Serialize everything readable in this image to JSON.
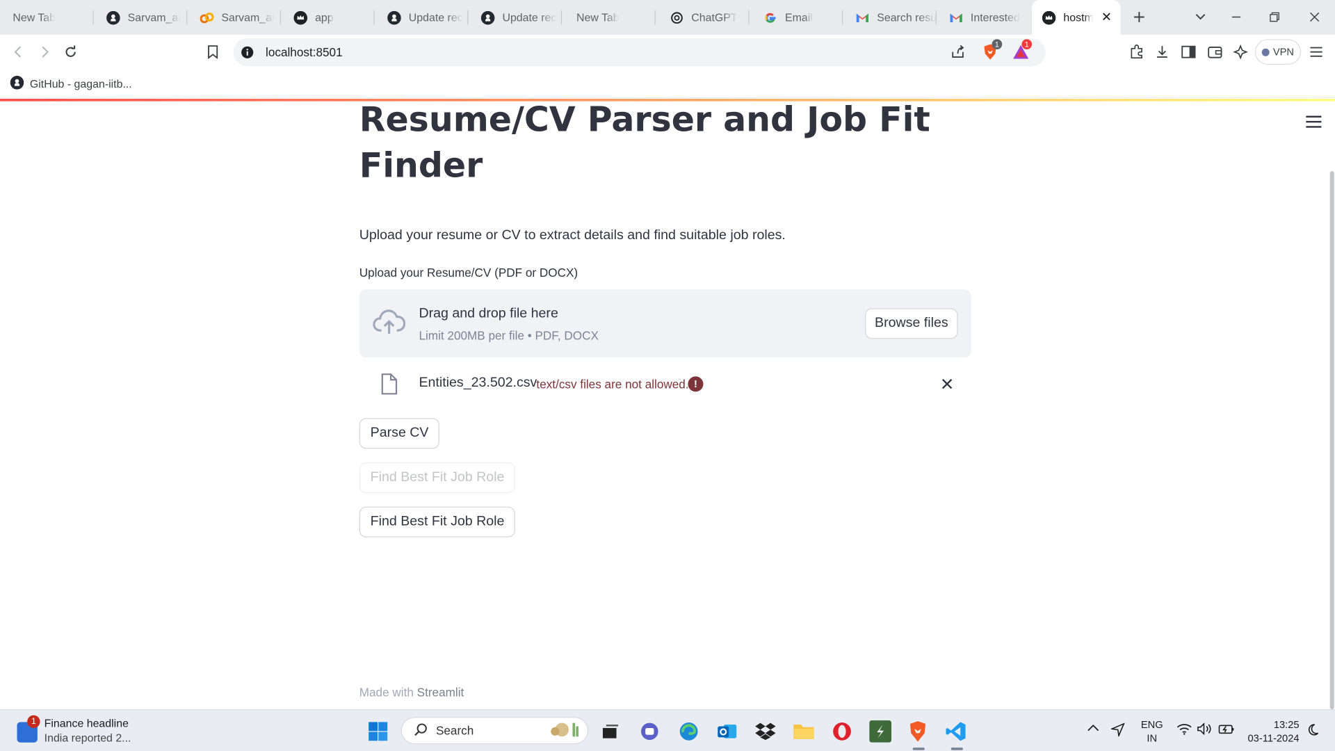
{
  "browser": {
    "tabs": [
      {
        "title": "New Tab",
        "icon": "none"
      },
      {
        "title": "Sarvam_ai",
        "icon": "github-icon"
      },
      {
        "title": "Sarvam_ai",
        "icon": "colab-icon"
      },
      {
        "title": "app",
        "icon": "streamlit-crown-icon"
      },
      {
        "title": "Update rec",
        "icon": "github-icon"
      },
      {
        "title": "Update rec",
        "icon": "github-icon"
      },
      {
        "title": "New Tab",
        "icon": "none"
      },
      {
        "title": "ChatGPT",
        "icon": "chatgpt-icon"
      },
      {
        "title": "Email",
        "icon": "google-icon"
      },
      {
        "title": "Search resu",
        "icon": "gmail-icon"
      },
      {
        "title": "Interested",
        "icon": "gmail-icon"
      },
      {
        "title": "hostm",
        "icon": "streamlit-crown-icon",
        "active": true
      }
    ],
    "url": "localhost:8501",
    "vpn_label": "VPN",
    "shield_badge": "1",
    "rewards_badge": "1",
    "bookmark": "GitHub - gagan-iitb..."
  },
  "app": {
    "title": "Resume/CV Parser and Job Fit Finder",
    "subtitle": "Upload your resume or CV to extract details and find suitable job roles.",
    "uploader": {
      "label": "Upload your Resume/CV (PDF or DOCX)",
      "drop_text": "Drag and drop file here",
      "limit_text": "Limit 200MB per file • PDF, DOCX",
      "browse_label": "Browse files"
    },
    "file": {
      "name": "Entities_23.502.csv",
      "error": "text/csv files are not allowed.",
      "error_glyph": "!"
    },
    "buttons": {
      "parse": "Parse CV",
      "find_disabled": "Find Best Fit Job Role",
      "find": "Find Best Fit Job Role"
    },
    "footer_prefix": "Made with",
    "footer_brand": "Streamlit"
  },
  "taskbar": {
    "news_badge": "1",
    "news_title": "Finance headline",
    "news_sub": "India reported 2...",
    "search_placeholder": "Search",
    "lang_line1": "ENG",
    "lang_line2": "IN",
    "time": "13:25",
    "date": "03-11-2024"
  },
  "colors": {
    "error": "#7d353b",
    "accent_gradient_start": "#ff4b4b",
    "accent_gradient_end": "#fffd80",
    "dropzone_bg": "#f0f2f6"
  }
}
